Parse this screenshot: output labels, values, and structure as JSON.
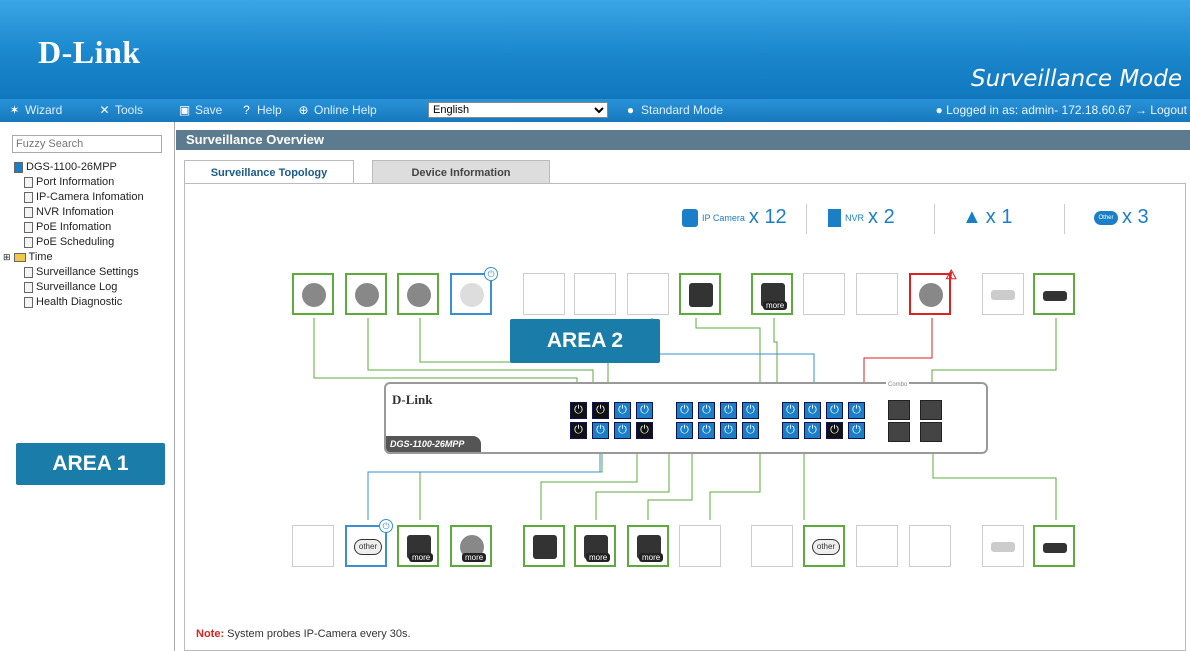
{
  "header": {
    "logo": "D-Link",
    "mode": "Surveillance Mode"
  },
  "toolbar": {
    "wizard": "Wizard",
    "tools": "Tools",
    "save": "Save",
    "help": "Help",
    "online_help": "Online Help",
    "language": "English",
    "standard_mode": "Standard Mode",
    "logged_in": "Logged in as: admin- 172.18.60.67",
    "logout": "Logout"
  },
  "sidebar": {
    "search_placeholder": "Fuzzy Search",
    "items": [
      {
        "label": "DGS-1100-26MPP"
      },
      {
        "label": "Port Information"
      },
      {
        "label": "IP-Camera Infomation"
      },
      {
        "label": "NVR Infomation"
      },
      {
        "label": "PoE Infomation"
      },
      {
        "label": "PoE Scheduling"
      },
      {
        "label": "Time"
      },
      {
        "label": "Surveillance Settings"
      },
      {
        "label": "Surveillance Log"
      },
      {
        "label": "Health Diagnostic"
      }
    ],
    "area_label": "AREA 1"
  },
  "main": {
    "title": "Surveillance Overview",
    "tabs": [
      "Surveillance Topology",
      "Device Information"
    ],
    "summary": {
      "ip_camera_label": "IP Camera",
      "ip_camera_count": "x 12",
      "nvr_label": "NVR",
      "nvr_count": "x 2",
      "alert_count": "x 1",
      "other_label": "Other",
      "other_count": "x 3"
    },
    "area_label": "AREA 2",
    "switch_brand": "D-Link",
    "switch_model": "DGS-1100-26MPP",
    "combo_label": "Combo",
    "more_label": "more",
    "other_label": "other",
    "note_prefix": "Note:",
    "note_text": " System probes IP-Camera every 30s."
  },
  "colors": {
    "accent": "#1a7fc6",
    "ok": "#5cab3c",
    "alert": "#dd2222"
  }
}
